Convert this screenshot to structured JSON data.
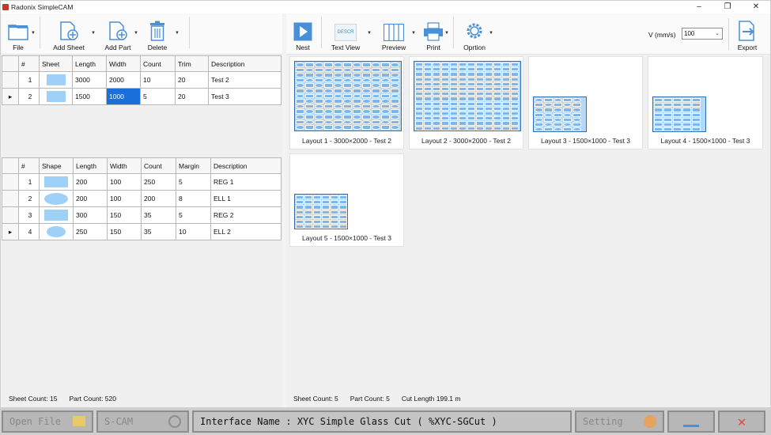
{
  "window": {
    "title": "Radonix SimpleCAM",
    "controls": [
      "–",
      "❐",
      "✕"
    ]
  },
  "left_toolbar": {
    "file": "File",
    "add_sheet": "Add Sheet",
    "add_part": "Add Part",
    "delete": "Delete"
  },
  "sheets_table": {
    "headers": [
      "#",
      "Sheet",
      "Length",
      "Width",
      "Count",
      "Trim",
      "Description"
    ],
    "rows": [
      {
        "num": "1",
        "length": "3000",
        "width": "2000",
        "count": "10",
        "trim": "20",
        "description": "Test 2"
      },
      {
        "num": "2",
        "length": "1500",
        "width": "1000",
        "count": "5",
        "trim": "20",
        "description": "Test 3"
      }
    ]
  },
  "parts_table": {
    "headers": [
      "#",
      "Shape",
      "Length",
      "Width",
      "Count",
      "Margin",
      "Description"
    ],
    "rows": [
      {
        "num": "1",
        "shape": "rect",
        "length": "200",
        "width": "100",
        "count": "250",
        "margin": "5",
        "description": "REG 1"
      },
      {
        "num": "2",
        "shape": "ellipse",
        "length": "200",
        "width": "100",
        "count": "200",
        "margin": "8",
        "description": "ELL 1"
      },
      {
        "num": "3",
        "shape": "rect",
        "length": "300",
        "width": "150",
        "count": "35",
        "margin": "5",
        "description": "REG 2"
      },
      {
        "num": "4",
        "shape": "ellipse",
        "length": "250",
        "width": "150",
        "count": "35",
        "margin": "10",
        "description": "ELL 2"
      }
    ]
  },
  "left_status": {
    "sheet_count": "Sheet Count: 15",
    "part_count": "Part Count: 520"
  },
  "right_toolbar": {
    "nest": "Nest",
    "text_view": "Text View",
    "text_view_icon_text": "DESCR",
    "preview": "Preview",
    "print": "Print",
    "option": "Oprtion",
    "speed_label": "V (mm/s)",
    "speed_value": "100",
    "export": "Export"
  },
  "layouts": [
    {
      "caption": "Layout 1 - 3000×2000 - Test 2"
    },
    {
      "caption": "Layout 2 - 3000×2000 - Test 2"
    },
    {
      "caption": "Layout 3 - 1500×1000 - Test 3"
    },
    {
      "caption": "Layout 4 - 1500×1000 - Test 3"
    },
    {
      "caption": "Layout 5 - 1500×1000 - Test 3"
    }
  ],
  "right_status": {
    "sheet_count": "Sheet Count: 5",
    "part_count": "Part Count: 5",
    "cut_length": "Cut Length 199.1 m"
  },
  "taskbar": {
    "open_file": "Open File",
    "scam": "S-CAM",
    "interface_name": "Interface Name : XYC Simple Glass Cut ( %XYC-SGCut )",
    "setting": "Setting"
  },
  "colors": {
    "selection": "#1a6fd8",
    "shape_fill": "#9fd0f7",
    "sheet_border": "#2f6fb4",
    "accent_icon": "#4a90d9"
  }
}
